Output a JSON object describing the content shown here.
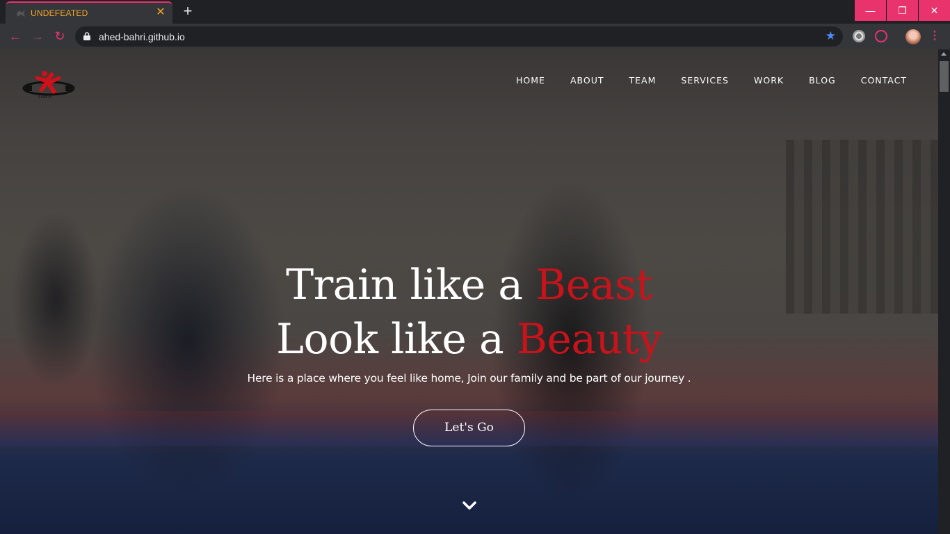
{
  "browser": {
    "tab_title": "UNDEFEATED",
    "url": "ahed-bahri.github.io",
    "accent_color": "#e8336d"
  },
  "site": {
    "nav": [
      "HOME",
      "ABOUT",
      "TEAM",
      "SERVICES",
      "WORK",
      "BLOG",
      "CONTACT"
    ],
    "hero": {
      "line1_prefix": "Train like a ",
      "line1_accent": "Beast",
      "line2_prefix": "Look like a ",
      "line2_accent": "Beauty",
      "subtitle": "Here is a place where you feel like home, Join our family and be part of our journey .",
      "cta_label": "Let's Go",
      "accent_color": "#c8131b"
    }
  },
  "icons": {
    "window": [
      "minimize-icon",
      "maximize-icon",
      "close-icon"
    ],
    "toolbar": [
      "back-icon",
      "forward-icon",
      "reload-icon",
      "lock-icon",
      "star-icon",
      "extension-icon",
      "profile-avatar",
      "menu-icon"
    ],
    "page": [
      "logo",
      "chevron-down-icon"
    ]
  }
}
